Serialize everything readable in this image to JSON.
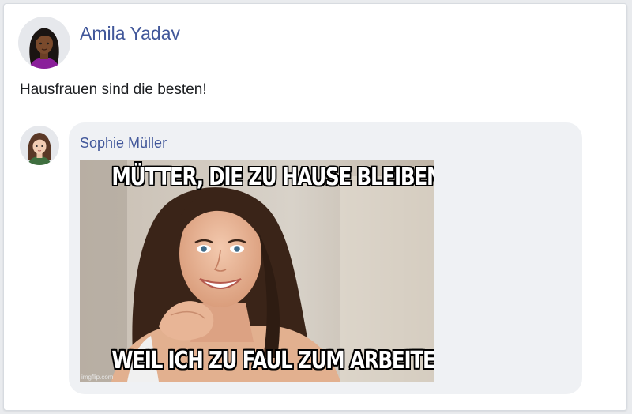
{
  "post": {
    "author": "Amila Yadav",
    "text": "Hausfrauen sind die besten!"
  },
  "comment": {
    "author": "Sophie Müller",
    "meme": {
      "top_text": "MÜTTER, DIE ZU HAUSE BLEIBEN:",
      "bottom_text": "WEIL ICH ZU FAUL ZUM ARBEITEN BIN",
      "watermark": "imgflip.com"
    }
  },
  "colors": {
    "name_link": "#41579a",
    "bubble": "#eff1f4",
    "page_bg": "#e9ebee"
  }
}
